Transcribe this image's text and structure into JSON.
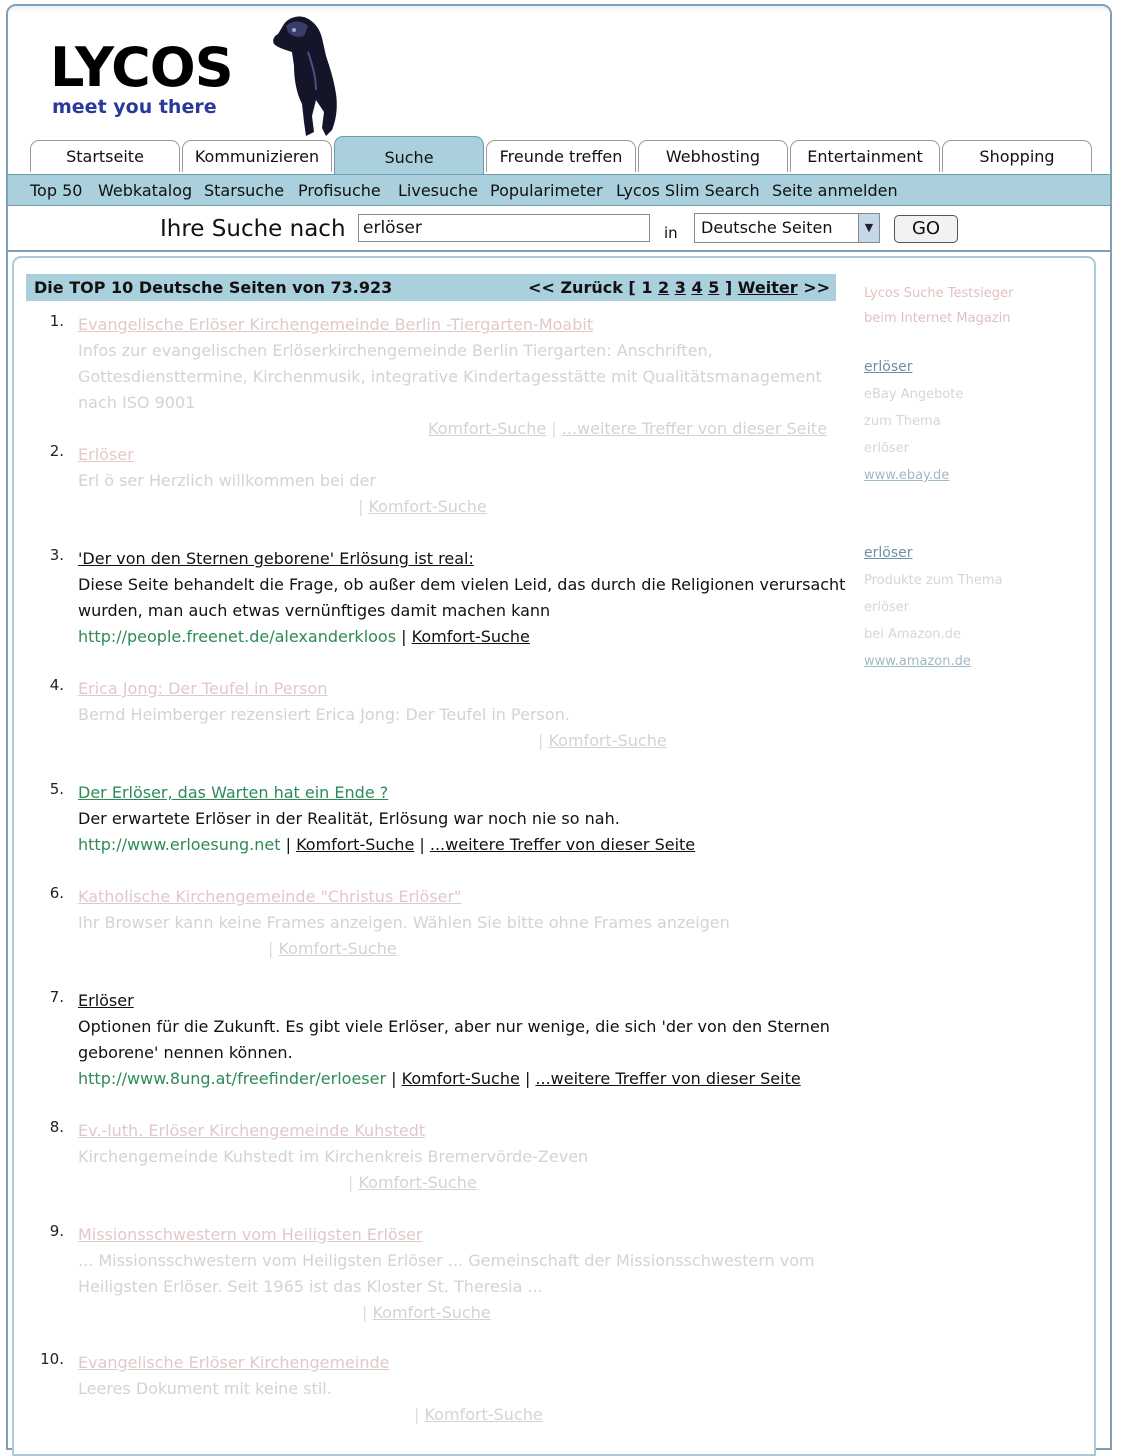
{
  "logo": {
    "word": "LYCOS",
    "tagline": "meet you there"
  },
  "tabs": [
    {
      "label": "Startseite"
    },
    {
      "label": "Kommunizieren"
    },
    {
      "label": "Suche"
    },
    {
      "label": "Freunde treffen"
    },
    {
      "label": "Webhosting"
    },
    {
      "label": "Entertainment"
    },
    {
      "label": "Shopping"
    }
  ],
  "active_tab": "Suche",
  "subnav": [
    {
      "label": "Top 50"
    },
    {
      "label": "Webkatalog"
    },
    {
      "label": "Starsuche"
    },
    {
      "label": "Profisuche"
    },
    {
      "label": "Livesuche"
    },
    {
      "label": "Popularimeter"
    },
    {
      "label": "Lycos Slim Search"
    },
    {
      "label": "Seite anmelden"
    }
  ],
  "search": {
    "label": "Ihre Suche nach",
    "value": "erlöser",
    "in_label": "in",
    "scope": "Deutsche Seiten",
    "go_label": "GO"
  },
  "results_header": {
    "title": "Die TOP 10 Deutsche Seiten von 73.923",
    "prev": "<< Zurück",
    "open": "[",
    "pages": [
      "1",
      "2",
      "3",
      "4",
      "5"
    ],
    "close": "]",
    "next": "Weiter",
    "next_arrow": ">>"
  },
  "results": [
    {
      "num": "1.",
      "title": "Evangelische Erlöser Kirchengemeinde Berlin -Tiergarten-Moabit",
      "desc": "Infos zur evangelischen Erlöserkirchengemeinde Berlin Tiergarten: Anschriften, Gottesdiensttermine, Kirchenmusik, integrative Kindertagesstätte mit Qualitätsmanagement nach ISO 9001",
      "url": "",
      "komfort": "Komfort-Suche",
      "weitere": "...weitere Treffer von dieser Seite"
    },
    {
      "num": "2.",
      "title": "Erlöser",
      "desc": "Erl ö ser Herzlich willkommen bei der",
      "url": "",
      "komfort": "Komfort-Suche",
      "weitere": ""
    },
    {
      "num": "3.",
      "title": "'Der von den Sternen geborene' Erlösung ist real:",
      "desc": "Diese Seite behandelt die Frage, ob außer dem vielen Leid, das durch die Religionen verursacht wurden, man auch etwas vernünftiges damit machen kann",
      "url": "http://people.freenet.de/alexanderkloos",
      "komfort": "Komfort-Suche",
      "weitere": ""
    },
    {
      "num": "4.",
      "title": "Erica Jong: Der Teufel in Person",
      "desc": "Bernd Heimberger rezensiert Erica Jong: Der Teufel in Person.",
      "url": "",
      "komfort": "Komfort-Suche",
      "weitere": ""
    },
    {
      "num": "5.",
      "title": "Der Erlöser, das Warten hat ein Ende ?",
      "desc": "Der erwartete Erlöser in der Realität, Erlösung war noch nie so nah.",
      "url": "http://www.erloesung.net",
      "komfort": "Komfort-Suche",
      "weitere": "...weitere Treffer von dieser Seite"
    },
    {
      "num": "6.",
      "title": "Katholische Kirchengemeinde \"Christus Erlöser\"",
      "desc": "Ihr Browser kann keine Frames anzeigen. Wählen Sie bitte ohne Frames anzeigen",
      "url": "",
      "komfort": "Komfort-Suche",
      "weitere": ""
    },
    {
      "num": "7.",
      "title": "Erlöser",
      "desc": "Optionen für die Zukunft. Es gibt viele Erlöser, aber nur wenige, die sich 'der von den Sternen geborene' nennen können.",
      "url": "http://www.8ung.at/freefinder/erloeser",
      "komfort": "Komfort-Suche",
      "weitere": "...weitere Treffer von dieser Seite"
    },
    {
      "num": "8.",
      "title": "Ev.-luth. Erlöser Kirchengemeinde Kuhstedt",
      "desc": "Kirchengemeinde Kuhstedt im Kirchenkreis Bremervörde-Zeven",
      "url": "",
      "komfort": "Komfort-Suche",
      "weitere": ""
    },
    {
      "num": "9.",
      "title": "Missionsschwestern vom Heiligsten Erlöser",
      "desc": "... Missionsschwestern vom Heiligsten Erlöser ... Gemeinschaft der Missionsschwestern vom Heiligsten Erlöser. Seit 1965 ist das Kloster St. Theresia ...",
      "url": "",
      "komfort": "Komfort-Suche",
      "weitere": ""
    },
    {
      "num": "10.",
      "title": "Evangelische Erlöser Kirchengemeinde",
      "desc": "Leeres Dokument mit keine stil.",
      "url": "",
      "komfort": "Komfort-Suche",
      "weitere": ""
    }
  ],
  "sidebar": {
    "top_line1": "Lycos Suche Testsieger",
    "top_line2": "beim Internet Magazin",
    "ebay_head": "erlöser",
    "ebay_l1": "eBay Angebote",
    "ebay_l2": "zum Thema",
    "ebay_l3": "erlöser",
    "ebay_link": "www.ebay.de",
    "amazon_head": "erlöser",
    "amazon_l1": "Produkte zum Thema",
    "amazon_l2": "erlöser",
    "amazon_l3": "bei Amazon.de",
    "amazon_link": "www.amazon.de"
  }
}
